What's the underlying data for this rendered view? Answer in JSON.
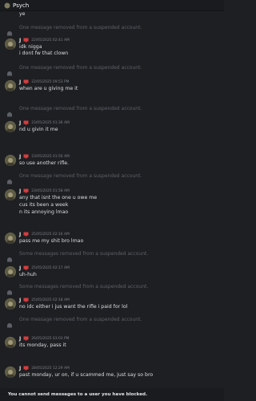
{
  "header": {
    "title": "Psych"
  },
  "top_fragment": "ye",
  "removed_single": "One message removed from a suspended account.",
  "removed_some": "Some messages removed from a suspended account.",
  "user": {
    "name": "J"
  },
  "messages": [
    {
      "time": "22/05/2025 02:41 AM",
      "lines": [
        "idk nigga",
        "i dont fw that clown"
      ]
    },
    {
      "time": "22/05/2025 09:53 PM",
      "lines": [
        "when are u giving me it"
      ]
    },
    {
      "time": "23/05/2025 01:36 AM",
      "lines": [
        "nd u givin it me"
      ]
    },
    {
      "time": "23/05/2025 01:56 AM",
      "lines": [
        "so use another rifle."
      ]
    },
    {
      "time": "23/05/2025 01:58 AM",
      "lines": [
        "any that isnt the one u owe me",
        "cus its been a week",
        "n its annoying lmao"
      ]
    },
    {
      "time": "25/05/2025 02:16 AM",
      "lines": [
        "pass me my shit bro lmao"
      ]
    },
    {
      "time": "25/05/2025 02:17 AM",
      "lines": [
        "uh-huh"
      ]
    },
    {
      "time": "25/05/2025 02:18 AM",
      "lines": [
        "no idc either i jus want the rifle i paid for lol"
      ]
    },
    {
      "time": "26/05/2025 03:03 PM",
      "lines": [
        "its monday, pass it"
      ]
    },
    {
      "time": "28/05/2025 12:29 AM",
      "lines": [
        "past monday, ur on, if u scammed me, just say so bro"
      ]
    }
  ],
  "footer": {
    "blocked_text": "You cannot send messages to a user you have blocked."
  },
  "colors": {
    "background": "#1e1f22",
    "removed_text": "#5d6068",
    "tag_red": "#d83c3e"
  }
}
